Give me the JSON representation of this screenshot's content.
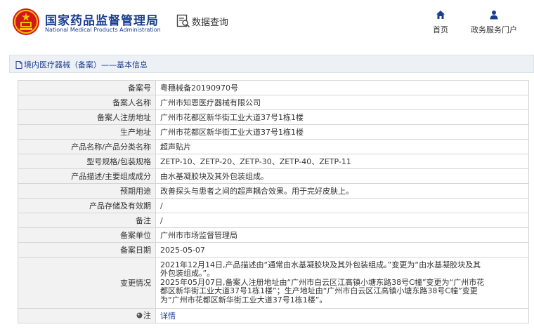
{
  "header": {
    "org_cn": "国家药品监督管理局",
    "org_en": "National Medical Products Administration",
    "query_label": "数据查询",
    "nav": {
      "home": "首页",
      "gov_portal": "政务服务门户"
    }
  },
  "panel": {
    "title": "境内医疗器械（备案）——基本信息"
  },
  "rows": [
    {
      "key": "备案号",
      "value": "粤穗械备20190970号"
    },
    {
      "key": "备案人名称",
      "value": "广州市知恩医疗器械有限公司"
    },
    {
      "key": "备案人注册地址",
      "value": "广州市花都区新华街工业大道37号1栋1楼"
    },
    {
      "key": "生产地址",
      "value": "广州市花都区新华街工业大道37号1栋1楼"
    },
    {
      "key": "产品名称/产品分类名称",
      "value": "超声贴片"
    },
    {
      "key": "型号规格/包装规格",
      "value": "ZETP-10、ZETP-20、ZETP-30、ZETP-40、ZETP-11"
    },
    {
      "key": "产品描述/主要组成成分",
      "value": "由水基凝胶块及其外包装组成。"
    },
    {
      "key": "预期用途",
      "value": "改善探头与患者之间的超声耦合效果。用于完好皮肤上。"
    },
    {
      "key": "产品存储及有效期",
      "value": "/"
    },
    {
      "key": "备注",
      "value": "/"
    },
    {
      "key": "备案单位",
      "value": "广州市市场监督管理局"
    },
    {
      "key": "备案日期",
      "value": "2025-05-07"
    }
  ],
  "change": {
    "key": "变更情况",
    "lines": [
      "2021年12月14日,产品描述由“通常由水基凝胶块及其外包装组成。”变更为“由水基凝胶块及其",
      "外包装组成。”。",
      "2025年05月07日,备案人注册地址由“广州市白云区江高镇小塘东路38号C幢”变更为“广州市花",
      "都区新华街工业大道37号1栋1楼”；生产地址由“广州市白云区江高镇小塘东路38号C幢”变更",
      "为“广州市花都区新华街工业大道37号1栋1楼”。"
    ]
  },
  "note": {
    "key": "注",
    "link": "详情"
  },
  "colors": {
    "brand": "#1a3f8f",
    "key_bg": "#f2f2f2",
    "panel_bg": "#edf1f6",
    "emblem_red": "#d4161c",
    "emblem_gold": "#f5c200"
  },
  "icons": [
    "national-emblem-icon",
    "data-query-icon",
    "home-icon",
    "user-icon",
    "document-icon",
    "pin-icon"
  ]
}
